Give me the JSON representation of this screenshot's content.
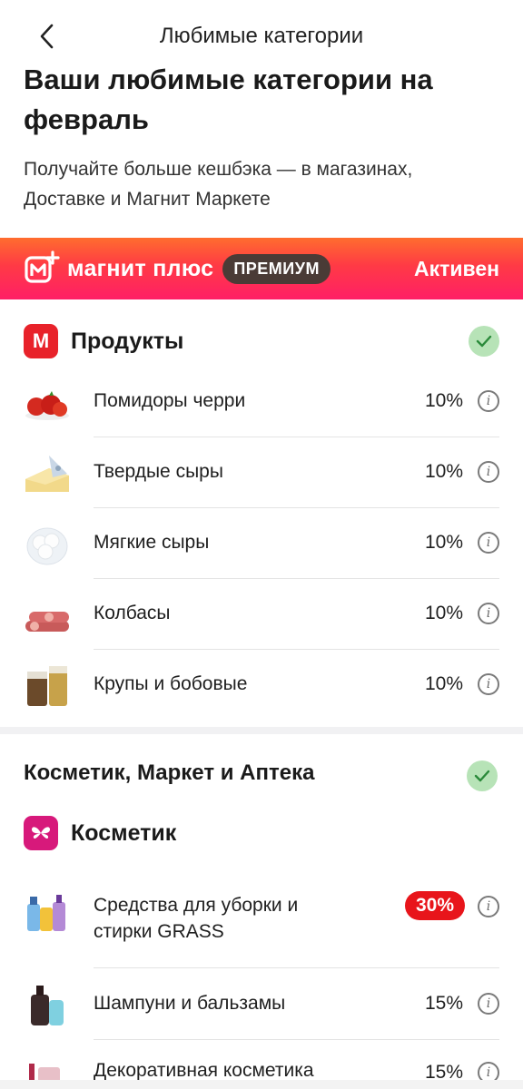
{
  "header": {
    "title": "Любимые категории",
    "back_icon": "chevron-left-icon"
  },
  "intro": {
    "headline": "Ваши любимые категории на февраль",
    "subtitle": "Получайте больше кешбэка — в магазинах, Доставке и Магнит Маркете"
  },
  "banner": {
    "brand": "магнит плюс",
    "tier": "ПРЕМИУМ",
    "status": "Активен",
    "colors": {
      "top": "#ff6d2e",
      "bottom": "#ff1f66"
    }
  },
  "products_section": {
    "title": "Продукты",
    "brand_letter": "М",
    "items": [
      {
        "label": "Помидоры черри",
        "percent": "10%",
        "icon": "cherry-tomatoes-image"
      },
      {
        "label": "Твердые сыры",
        "percent": "10%",
        "icon": "hard-cheese-image"
      },
      {
        "label": "Мягкие сыры",
        "percent": "10%",
        "icon": "soft-cheese-image"
      },
      {
        "label": "Колбасы",
        "percent": "10%",
        "icon": "sausages-image"
      },
      {
        "label": "Крупы и бобовые",
        "percent": "10%",
        "icon": "grains-image"
      }
    ]
  },
  "cosmetics_group": {
    "title": "Косметик, Маркет и Аптека",
    "section_title": "Косметик",
    "items": [
      {
        "label_line1": "Средства для уборки и",
        "label_line2": "стирки GRASS",
        "percent": "30%",
        "highlight": true,
        "icon": "cleaning-products-image"
      },
      {
        "label": "Шампуни и бальзамы",
        "percent": "15%",
        "icon": "shampoo-image"
      },
      {
        "label": "Декоративная косметика",
        "percent": "15%",
        "icon": "makeup-image"
      }
    ]
  },
  "info_glyph": "i",
  "accent_colors": {
    "magnit_red": "#e8222a",
    "cosmetic_pink": "#d7197b",
    "check_green": "#b7e3b7",
    "badge_red": "#e8151b"
  }
}
